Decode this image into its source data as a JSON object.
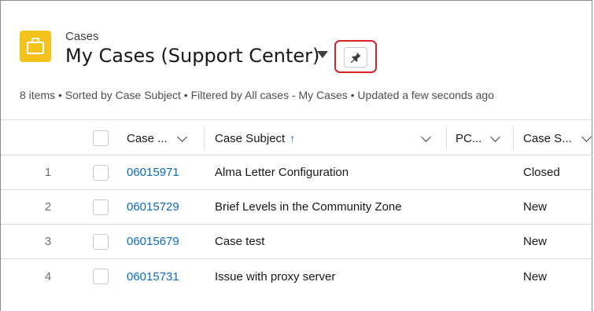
{
  "header": {
    "object_label": "Cases",
    "list_title": "My Cases (Support Center)",
    "meta": "8 items • Sorted by Case Subject • Filtered by All cases - My Cases • Updated a few seconds ago"
  },
  "icons": {
    "object_icon": "briefcase-icon",
    "pin_icon": "pin-icon",
    "sort_icon": "arrow-up-icon",
    "column_menu_icon": "chevron-down-icon"
  },
  "colors": {
    "object_icon_bg": "#f5c21b",
    "link": "#0b6cbf",
    "highlight": "#d9232d"
  },
  "table": {
    "columns": [
      {
        "label": "Case ..."
      },
      {
        "label": "Case Subject",
        "sort_indicator": "↑"
      },
      {
        "label": "PC..."
      },
      {
        "label": "Case S..."
      }
    ],
    "rows": [
      {
        "num": "1",
        "case_number": "06015971",
        "subject": "Alma Letter Configuration",
        "status": "Closed"
      },
      {
        "num": "2",
        "case_number": "06015729",
        "subject": "Brief Levels in the Community Zone",
        "status": "New"
      },
      {
        "num": "3",
        "case_number": "06015679",
        "subject": "Case test",
        "status": "New"
      },
      {
        "num": "4",
        "case_number": "06015731",
        "subject": "Issue with proxy server",
        "status": "New"
      }
    ]
  }
}
